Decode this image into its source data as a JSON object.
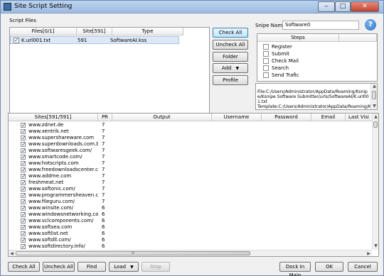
{
  "window": {
    "title": "Site Script Setting",
    "min_label": "‒",
    "max_label": "□",
    "close_label": "✕"
  },
  "script_files": {
    "group_label": "Script Files",
    "columns": [
      "Files[0/1]",
      "Site[591]",
      "Type"
    ],
    "rows": [
      {
        "checked": true,
        "file": "K.url001.txt",
        "site": "591",
        "type": "SoftwareAI.kss"
      }
    ]
  },
  "buttons": {
    "check_all": "Check All",
    "uncheck_all": "Uncheck All",
    "folder_setting": "Folder Setting",
    "add": "Add",
    "profile": "Profile"
  },
  "snipe": {
    "label": "Snipe Name:",
    "value": "Software0",
    "help": "?"
  },
  "steps": {
    "header": "Steps",
    "items": [
      {
        "label": "Register",
        "checked": false
      },
      {
        "label": "Submit",
        "checked": false
      },
      {
        "label": "Check Mail",
        "checked": false
      },
      {
        "label": "Search",
        "checked": false
      },
      {
        "label": "Send Trafic",
        "checked": false
      }
    ]
  },
  "info_text": "File:C:/Users/Administrator/AppData/Roaming/Ksnipe/Ksnipe Software Submitter/urls/SoftwareAI/K.url001.txt\nTemplate:C:/Users/Administrator/AppData/Roaming/Ksnipe/Ksnipe Software",
  "sites": {
    "columns": [
      "Sites[591/591]",
      "PR",
      "Output",
      "Username",
      "Password",
      "Email",
      "Last Visi"
    ],
    "rows": [
      {
        "site": "www.zdnet.de",
        "pr": "7"
      },
      {
        "site": "www.xentrik.net",
        "pr": "7"
      },
      {
        "site": "www.supershareware.com",
        "pr": "7"
      },
      {
        "site": "www.superdownloads.com.br",
        "pr": "7"
      },
      {
        "site": "www.softwaresgeek.com/",
        "pr": "7"
      },
      {
        "site": "www.smartcode.com/",
        "pr": "7"
      },
      {
        "site": "www.hotscripts.com",
        "pr": "7"
      },
      {
        "site": "www.freedownloadscenter.com",
        "pr": "7"
      },
      {
        "site": "www.addme.com",
        "pr": "7"
      },
      {
        "site": "freshmeat.net",
        "pr": "7"
      },
      {
        "site": "www.softonic.com/",
        "pr": "7"
      },
      {
        "site": "www.programmersheaven.com",
        "pr": "7"
      },
      {
        "site": "www.fileguru.com/",
        "pr": "7"
      },
      {
        "site": "www.winsite.com/",
        "pr": "6"
      },
      {
        "site": "www.windowsnetworking.com",
        "pr": "6"
      },
      {
        "site": "www.vclcomponents.com/",
        "pr": "6"
      },
      {
        "site": "www.softsea.com",
        "pr": "6"
      },
      {
        "site": "www.softlist.net",
        "pr": "6"
      },
      {
        "site": "www.softdll.com/",
        "pr": "6"
      },
      {
        "site": "www.softdirectory.info/",
        "pr": "6"
      }
    ],
    "hscroll_label": "III"
  },
  "bottom": {
    "check_all": "Check All",
    "uncheck_all": "Uncheck All",
    "find": "Find",
    "load": "Load",
    "stop": "Stop",
    "dock_in_main": "Dock In Main",
    "ok": "OK",
    "cancel": "Cancel"
  }
}
